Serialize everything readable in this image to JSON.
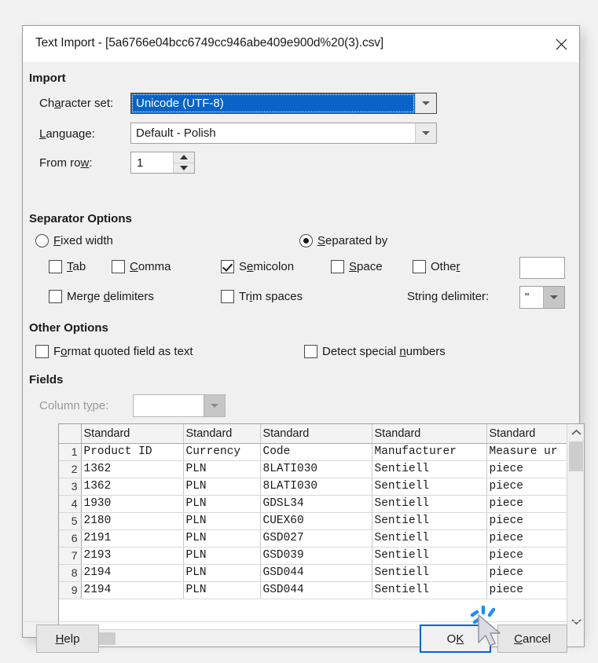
{
  "dialog": {
    "title": "Text Import - [5a6766e04bcc6749cc946abe409e900d%20(3).csv]",
    "close_icon": "close-icon"
  },
  "import_section": {
    "heading": "Import",
    "charset": {
      "label_pre": "Ch",
      "label_mnemonic": "a",
      "label_post": "racter set:",
      "value": "Unicode (UTF-8)"
    },
    "language": {
      "label_pre": "",
      "label_mnemonic": "L",
      "label_post": "anguage:",
      "value": "Default - Polish"
    },
    "from_row": {
      "label_pre": "From ro",
      "label_mnemonic": "w",
      "label_post": ":",
      "value": "1"
    }
  },
  "separator_section": {
    "heading": "Separator Options",
    "fixed_width": {
      "pre": "",
      "mnemonic": "F",
      "post": "ixed width",
      "checked": false
    },
    "separated_by": {
      "pre": "",
      "mnemonic": "S",
      "post": "eparated by",
      "checked": true
    },
    "tab": {
      "pre": "",
      "mnemonic": "T",
      "post": "ab",
      "checked": false
    },
    "comma": {
      "pre": "",
      "mnemonic": "C",
      "post": "omma",
      "checked": false
    },
    "semicolon": {
      "pre": "S",
      "mnemonic": "e",
      "post": "micolon",
      "checked": true
    },
    "space": {
      "pre": "",
      "mnemonic": "S",
      "post": "pace",
      "checked": false
    },
    "other": {
      "pre": "Othe",
      "mnemonic": "r",
      "post": "",
      "checked": false
    },
    "other_value": "",
    "merge_delimiters": {
      "pre": "Merge ",
      "mnemonic": "d",
      "post": "elimiters",
      "checked": false
    },
    "trim_spaces": {
      "pre": "Tr",
      "mnemonic": "i",
      "post": "m spaces",
      "checked": false
    },
    "string_delimiter": {
      "label_pre": "String delimiter",
      "label_mnemonic": "",
      "label_post": ":",
      "value": "\""
    }
  },
  "other_options_section": {
    "heading": "Other Options",
    "format_quoted": {
      "pre": "F",
      "mnemonic": "o",
      "post": "rmat quoted field as text",
      "checked": false
    },
    "detect_numbers": {
      "pre": "Detect special ",
      "mnemonic": "n",
      "post": "umbers",
      "checked": false
    }
  },
  "fields_section": {
    "heading": "Fields",
    "column_type": {
      "label_pre": "Column t",
      "label_mnemonic": "y",
      "label_post": "pe:",
      "value": "",
      "disabled": true
    }
  },
  "preview": {
    "column_headers": [
      "Standard",
      "Standard",
      "Standard",
      "Standard",
      "Standard"
    ],
    "rows": [
      {
        "n": "1",
        "cells": [
          "Product ID",
          "Currency",
          "Code",
          "Manufacturer",
          "Measure ur"
        ]
      },
      {
        "n": "2",
        "cells": [
          "1362",
          "PLN",
          "8LATI030",
          "Sentiell",
          "piece"
        ]
      },
      {
        "n": "3",
        "cells": [
          "1362",
          "PLN",
          "8LATI030",
          "Sentiell",
          "piece"
        ]
      },
      {
        "n": "4",
        "cells": [
          "1930",
          "PLN",
          "GDSL34",
          "Sentiell",
          "piece"
        ]
      },
      {
        "n": "5",
        "cells": [
          "2180",
          "PLN",
          "CUEX60",
          "Sentiell",
          "piece"
        ]
      },
      {
        "n": "6",
        "cells": [
          "2191",
          "PLN",
          "GSD027",
          "Sentiell",
          "piece"
        ]
      },
      {
        "n": "7",
        "cells": [
          "2193",
          "PLN",
          "GSD039",
          "Sentiell",
          "piece"
        ]
      },
      {
        "n": "8",
        "cells": [
          "2194",
          "PLN",
          "GSD044",
          "Sentiell",
          "piece"
        ]
      },
      {
        "n": "9",
        "cells": [
          "2194",
          "PLN",
          "GSD044",
          "Sentiell",
          "piece"
        ]
      }
    ],
    "scroll_up_icon": "chevron-up-icon",
    "scroll_down_icon": "chevron-down-icon",
    "scroll_left_icon": "chevron-left-icon",
    "scroll_right_icon": "chevron-right-icon"
  },
  "footer": {
    "help": {
      "pre": "",
      "mnemonic": "H",
      "post": "elp"
    },
    "ok": {
      "pre": "O",
      "mnemonic": "K",
      "post": ""
    },
    "cancel": {
      "pre": "",
      "mnemonic": "C",
      "post": "ancel"
    }
  },
  "colors": {
    "accent": "#0a64c8",
    "selection": "#0a64c8",
    "dialog_bg": "#f0f0f0",
    "titlebar_bg": "#ffffff",
    "click_burst": "#1e90f0"
  }
}
